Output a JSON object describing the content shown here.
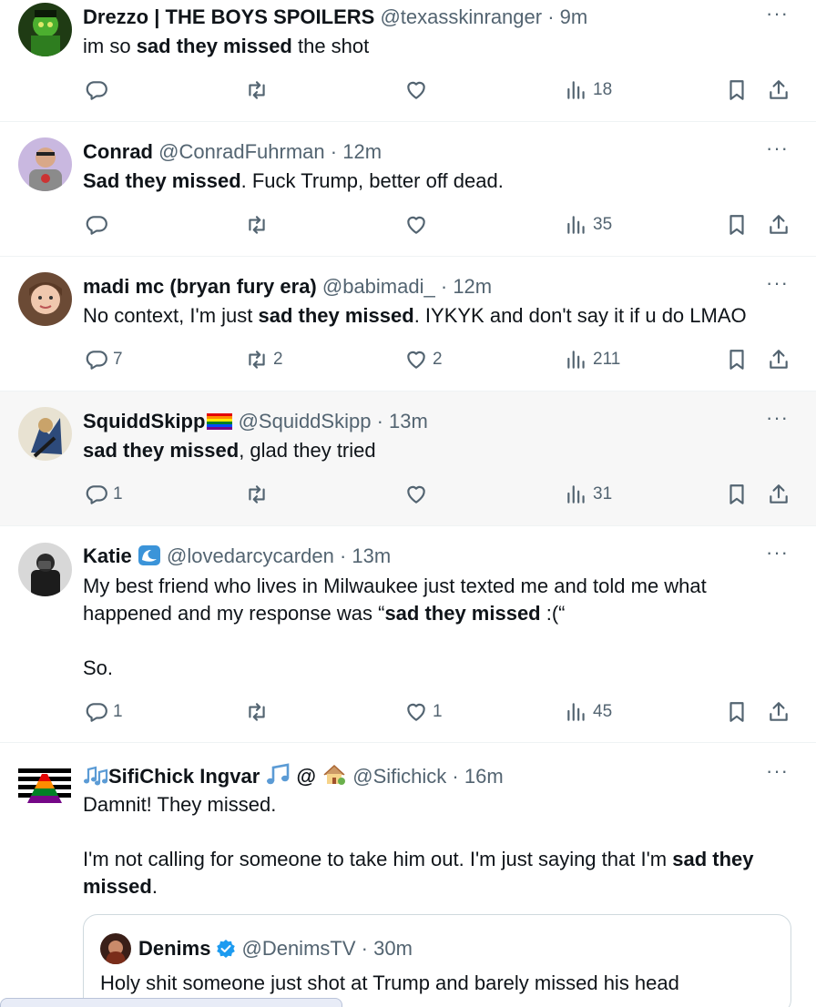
{
  "actions_labels": {
    "reply": "",
    "repost": "",
    "like": "",
    "views": "",
    "bookmark": "",
    "share": ""
  },
  "tweets": [
    {
      "name": "Drezzo | THE BOYS SPOILERS",
      "handle": "@texasskinranger",
      "time": "9m",
      "body": {
        "pre": "im so ",
        "bold": "sad they missed",
        "post": " the shot"
      },
      "replies": "",
      "reposts": "",
      "likes": "",
      "views": "18"
    },
    {
      "name": "Conrad",
      "handle": "@ConradFuhrman",
      "time": "12m",
      "body": {
        "pre": "",
        "bold": "Sad they missed",
        "post": ". Fuck Trump, better off dead."
      },
      "replies": "",
      "reposts": "",
      "likes": "",
      "views": "35"
    },
    {
      "name": "madi mc (bryan fury era)",
      "handle": "@babimadi_",
      "time": "12m",
      "body": {
        "pre": "No context, I'm just ",
        "bold": "sad they missed",
        "post": ". IYKYK and don't say it if u do LMAO"
      },
      "replies": "7",
      "reposts": "2",
      "likes": "2",
      "views": "211"
    },
    {
      "name": "SquiddSkipp",
      "handle": "@SquiddSkipp",
      "time": "13m",
      "body": {
        "pre": "",
        "bold": "sad they missed",
        "post": ", glad they tried"
      },
      "replies": "1",
      "reposts": "",
      "likes": "",
      "views": "31"
    },
    {
      "name": "Katie",
      "handle": "@lovedarcycarden",
      "time": "13m",
      "body": {
        "line1": "My best friend who lives in Milwaukee just texted me and told me what",
        "line2_pre": "happened and my response was “",
        "line2_bold": "sad they missed",
        "line2_post": " :(“",
        "line3": "So."
      },
      "replies": "1",
      "reposts": "",
      "likes": "1",
      "views": "45"
    },
    {
      "name": "SifiChick Ingvar",
      "name_suffix": "@",
      "handle": "@Sifichick",
      "time": "16m",
      "body": {
        "line1": "Damnit! They missed.",
        "line2_pre": "I'm not calling for someone to take him out. I'm just saying that I'm ",
        "line2_bold": "sad they",
        "line3_bold": "missed",
        "line3_post": "."
      },
      "quote": {
        "name": "Denims",
        "handle": "@DenimsTV",
        "time": "30m",
        "text": "Holy shit someone just shot at Trump and barely missed his head"
      }
    }
  ],
  "separator": "·",
  "more_label": "···",
  "colors": {
    "text": "#0f1419",
    "muted": "#536471",
    "border": "#eff3f4",
    "hover": "#f7f7f7",
    "verified": "#1d9bf0"
  }
}
